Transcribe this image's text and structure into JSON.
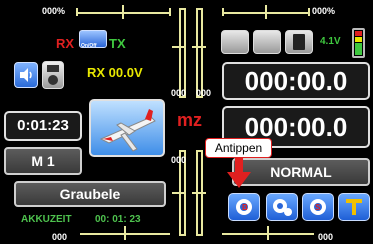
{
  "trims": {
    "top_left_pct": "000%",
    "top_right_pct": "000%",
    "mid_left_val": "000",
    "mid_mid_val": "000",
    "lower_left_val": "000",
    "bottom_left_val": "000",
    "bottom_right_val": "000"
  },
  "status": {
    "rx_label": "RX",
    "tx_label": "TX",
    "rx_voltage": "RX 00.0V",
    "battery_voltage": "4.1V",
    "module_label": "On/Off"
  },
  "timers": {
    "timer1": "000:00.0",
    "timer2": "000:00.0",
    "stopwatch": "0:01:23"
  },
  "model": {
    "memory": "M 1",
    "name": "Graubele",
    "mode": "mz",
    "phase": "NORMAL",
    "akku_label": "AKKUZEIT",
    "akku_time": "00: 01: 23"
  },
  "callout": {
    "text": "Antippen"
  },
  "colors": {
    "rx_red": "#e02020",
    "tx_green": "#3fc83f",
    "voltage_yellow": "#e8e800",
    "mode_red": "#e02020",
    "akku_green": "#4ec24e"
  },
  "icons": {
    "speaker": "speaker-icon",
    "mp3": "mp3-player-icon",
    "sd_card": "sd-card-icon",
    "battery": "battery-icon",
    "plane": "airplane-model-icon",
    "gear1": "gear-b-icon",
    "gear2": "gear-settings-icon",
    "gear3": "gear-s-icon",
    "telemetry": "telemetry-t-icon"
  }
}
